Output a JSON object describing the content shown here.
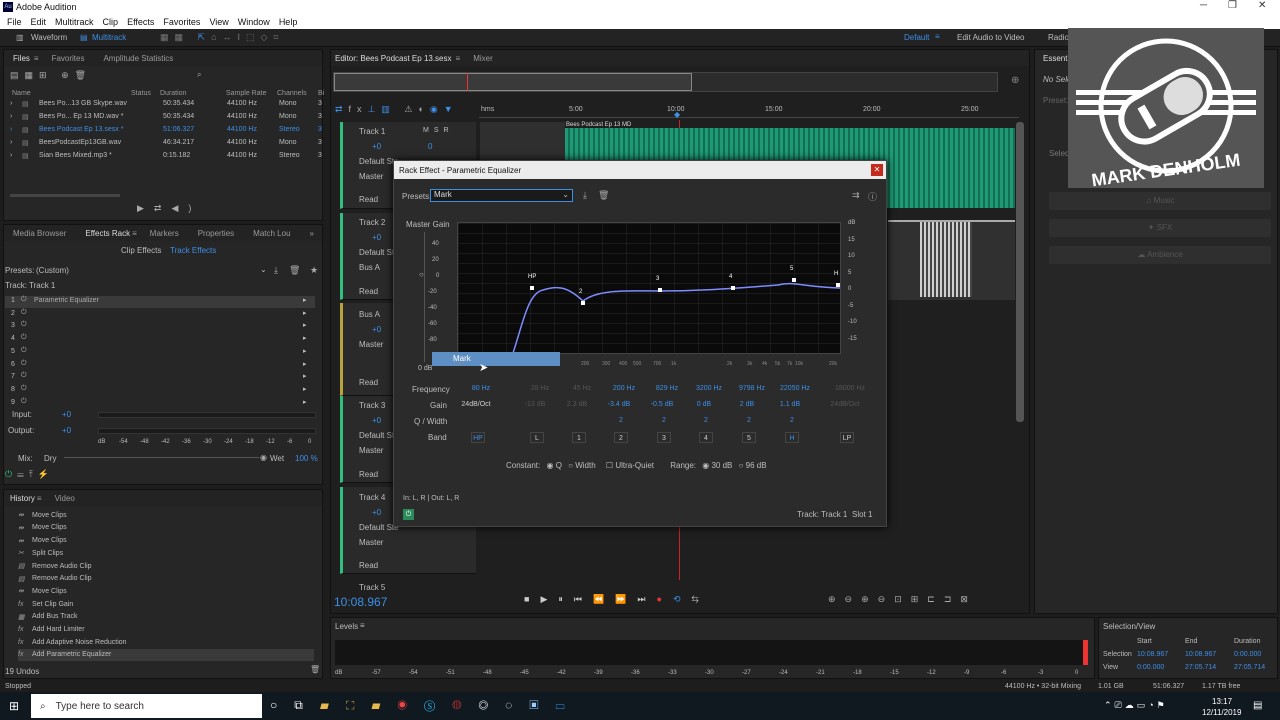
{
  "app": {
    "title": "Adobe Audition"
  },
  "menu": [
    "File",
    "Edit",
    "Multitrack",
    "Clip",
    "Effects",
    "Favorites",
    "View",
    "Window",
    "Help"
  ],
  "toolbar": {
    "waveform": "Waveform",
    "multitrack": "Multitrack",
    "workspace": "Default",
    "edit_video": "Edit Audio to Video",
    "radio": "Radio"
  },
  "files": {
    "tabs": [
      "Files",
      "Favorites",
      "Amplitude Statistics"
    ],
    "columns": [
      "Name",
      "Status",
      "Duration",
      "Sample Rate",
      "Channels",
      "Bi"
    ],
    "rows": [
      {
        "name": "Bees Po...13 GB Skype.wav",
        "duration": "50:35.434",
        "rate": "44100 Hz",
        "ch": "Mono",
        "b": "3"
      },
      {
        "name": "Bees Po... Ep 13 MD.wav *",
        "duration": "50:35.434",
        "rate": "44100 Hz",
        "ch": "Mono",
        "b": "3"
      },
      {
        "name": "Bees Podcast Ep 13.sesx *",
        "duration": "51:06.327",
        "rate": "44100 Hz",
        "ch": "Stereo",
        "b": "3"
      },
      {
        "name": "BeesPodcastEp13GB.wav",
        "duration": "46:34.217",
        "rate": "44100 Hz",
        "ch": "Mono",
        "b": "3"
      },
      {
        "name": "Sian Bees Mixed.mp3 *",
        "duration": "0:15.182",
        "rate": "44100 Hz",
        "ch": "Stereo",
        "b": "3"
      }
    ]
  },
  "effects": {
    "tabs": [
      "Media Browser",
      "Effects Rack",
      "Markers",
      "Properties",
      "Match Lou"
    ],
    "subtabs": [
      "Clip Effects",
      "Track Effects"
    ],
    "presets_label": "Presets:",
    "preset": "(Custom)",
    "track": "Track: Track 1",
    "slots": [
      "Parametric Equalizer",
      "",
      "",
      "",
      "",
      "",
      "",
      "",
      ""
    ],
    "slot_nums": [
      "1",
      "2",
      "3",
      "4",
      "5",
      "6",
      "7",
      "8",
      "9"
    ],
    "input_label": "Input:",
    "input_val": "+0",
    "output_label": "Output:",
    "output_val": "+0",
    "meter_ticks": [
      "dB",
      "-54",
      "-48",
      "-42",
      "-36",
      "-30",
      "-24",
      "-18",
      "-12",
      "-6",
      "0"
    ],
    "mix": "Mix:",
    "dry": "Dry",
    "wet": "Wet",
    "mix_pct": "100 %"
  },
  "history": {
    "tabs": [
      "History",
      "Video"
    ],
    "items": [
      "Move Clips",
      "Move Clips",
      "Move Clips",
      "Split Clips",
      "Remove Audio Clip",
      "Remove Audio Clip",
      "Move Clips",
      "Set Clip Gain",
      "Add Bus Track",
      "Add Hard Limiter",
      "Add Adaptive Noise Reduction",
      "Add Parametric Equalizer"
    ],
    "undos": "19 Undos",
    "status": "Stopped"
  },
  "editor": {
    "tab": "Editor: Bees Podcast Ep 13.sesx",
    "mixer": "Mixer",
    "ruler": [
      "hms",
      "5:00",
      "10:00",
      "15:00",
      "20:00",
      "25:00"
    ],
    "time": "10:08.967",
    "clip_label": "Bees Podcast Ep 13 MD",
    "tracks": [
      {
        "name": "Track 1",
        "vol": "+0",
        "pan": "0",
        "input": "Default Ste",
        "out": "Master",
        "mode": "Read"
      },
      {
        "name": "Track 2",
        "vol": "+0",
        "input": "Default Ste",
        "out": "Bus A",
        "mode": "Read"
      },
      {
        "name": "Bus A",
        "vol": "+0",
        "out": "Master",
        "mode": "Read"
      },
      {
        "name": "Track 3",
        "vol": "+0",
        "input": "Default Ste",
        "out": "Master",
        "mode": "Read"
      },
      {
        "name": "Track 4",
        "vol": "+0",
        "input": "Default Ste",
        "out": "Master",
        "mode": "Read"
      },
      {
        "name": "Track 5"
      }
    ]
  },
  "dialog": {
    "title": "Rack Effect - Parametric Equalizer",
    "presets_label": "Presets:",
    "preset": "Mark",
    "master_gain": "Master Gain",
    "left_scale": [
      "40",
      "20",
      "0",
      "-20",
      "-40",
      "-60",
      "-80"
    ],
    "right_scale": [
      "dB",
      "15",
      "10",
      "5",
      "0",
      "-5",
      "-10",
      "-15"
    ],
    "points": [
      "HP",
      "2",
      "3",
      "4",
      "5",
      "H"
    ],
    "freq_ticks": [
      "Hz",
      "200",
      "300",
      "400",
      "500",
      "700",
      "1k",
      "2k",
      "3k",
      "4k",
      "5k",
      "7k",
      "10k",
      "20k"
    ],
    "zero_db": "0 dB",
    "tooltip": "Mark",
    "freq_label": "Frequency",
    "gain_label": "Gain",
    "q_label": "Q / Width",
    "band_label": "Band",
    "frequencies": [
      "80 Hz",
      "28 Hz",
      "45 Hz",
      "200 Hz",
      "829 Hz",
      "3200 Hz",
      "9798 Hz",
      "22050 Hz",
      "18000 Hz"
    ],
    "gains": [
      "24dB/Oct",
      "-13 dB",
      "2.3 dB",
      "-3.4 dB",
      "-0.5 dB",
      "0 dB",
      "2 dB",
      "1.1 dB",
      "24dB/Oct"
    ],
    "qs": [
      "2",
      "2",
      "2",
      "2",
      "2"
    ],
    "bands": [
      "HP",
      "L",
      "1",
      "2",
      "3",
      "4",
      "5",
      "H",
      "LP"
    ],
    "constant": "Constant:",
    "q": "Q",
    "width": "Width",
    "ultra": "Ultra-Quiet",
    "range": "Range:",
    "r30": "30 dB",
    "r96": "96 dB",
    "io": "In: L, R | Out: L, R",
    "track": "Track: Track 1",
    "slot": "Slot 1"
  },
  "levels": {
    "label": "Levels",
    "ticks": [
      "dB",
      "-57",
      "-54",
      "-51",
      "-48",
      "-45",
      "-42",
      "-39",
      "-36",
      "-33",
      "-30",
      "-27",
      "-24",
      "-21",
      "-18",
      "-15",
      "-12",
      "-9",
      "-6",
      "-3",
      "0"
    ]
  },
  "selection": {
    "title": "Selection/View",
    "start": "Start",
    "end": "End",
    "duration": "Duration",
    "selection": "Selection",
    "sel_start": "10:08.967",
    "sel_end": "10:08.967",
    "sel_dur": "0:00.000",
    "view": "View",
    "view_start": "0:00.000",
    "view_end": "27:05.714",
    "view_dur": "27:05.714"
  },
  "status": {
    "mix": "44100 Hz • 32-bit Mixing",
    "size": "1.01 GB",
    "dur": "51:06.327",
    "free": "1.17 TB free"
  },
  "essential": {
    "title": "Essential",
    "no_sel": "No Selecti",
    "preset": "Preset:",
    "select": "Select",
    "music": "Music",
    "sfx": "SFX",
    "ambience": "Ambience"
  },
  "logo": {
    "text": "MARK DENHOLM"
  },
  "taskbar": {
    "search": "Type here to search",
    "time": "13:17",
    "date": "12/11/2019"
  }
}
